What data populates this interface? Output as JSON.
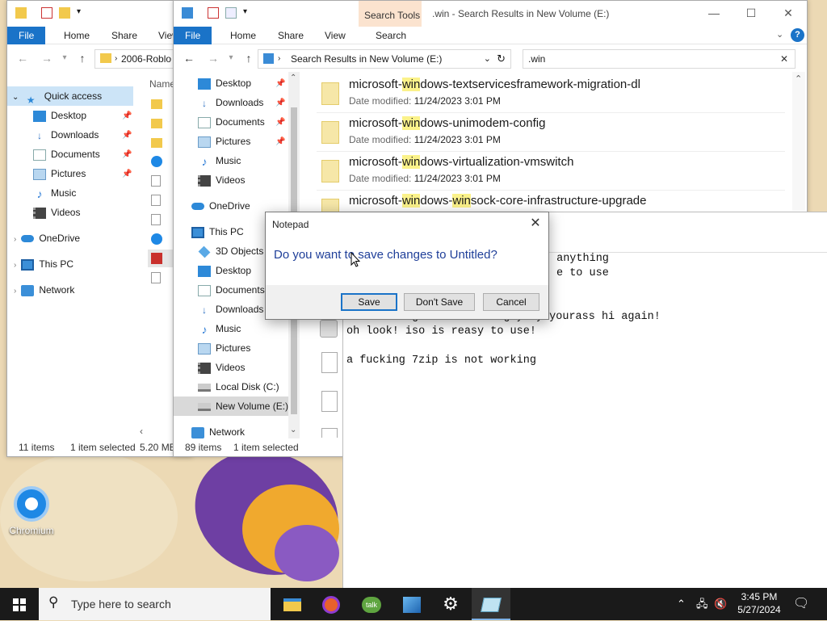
{
  "desktop": {
    "icons": [
      {
        "label": "Chromium",
        "icon": "chromium-icon"
      }
    ]
  },
  "explorer_back": {
    "ribbon_tabs": [
      "File",
      "Home",
      "Share",
      "View"
    ],
    "address": "2006-Roblo",
    "nav": {
      "quick_access": "Quick access",
      "items": [
        "Desktop",
        "Downloads",
        "Documents",
        "Pictures",
        "Music",
        "Videos"
      ],
      "onedrive": "OneDrive",
      "this_pc": "This PC",
      "network": "Network"
    },
    "column_header": "Name",
    "status": {
      "count": "11 items",
      "selected": "1 item selected",
      "size": "5.20 MB"
    }
  },
  "explorer_front": {
    "title": ".win - Search Results in New Volume (E:)",
    "contextual_tab": "Search Tools",
    "ribbon_tabs": [
      "File",
      "Home",
      "Share",
      "View",
      "Search"
    ],
    "address": "Search Results in New Volume (E:)",
    "search_query": ".win",
    "nav": {
      "quick_items": [
        "Desktop",
        "Downloads",
        "Documents",
        "Pictures",
        "Music",
        "Videos"
      ],
      "onedrive": "OneDrive",
      "this_pc": "This PC",
      "pc_items": [
        "3D Objects",
        "Desktop",
        "Documents",
        "Downloads",
        "Music",
        "Pictures",
        "Videos",
        "Local Disk (C:)",
        "New Volume (E:)"
      ],
      "network": "Network"
    },
    "results": [
      {
        "pre": "microsoft-",
        "hl": "win",
        "post": "dows-textservicesframework-migration-dl",
        "date_label": "Date modified:",
        "date": "11/24/2023 3:01 PM"
      },
      {
        "pre": "microsoft-",
        "hl": "win",
        "post": "dows-unimodem-config",
        "date_label": "Date modified:",
        "date": "11/24/2023 3:01 PM"
      },
      {
        "pre": "microsoft-",
        "hl": "win",
        "post": "dows-virtualization-vmswitch",
        "date_label": "Date modified:",
        "date": "11/24/2023 3:01 PM"
      },
      {
        "pre": "microsoft-",
        "hl": "win",
        "post": "dows-",
        "hl2": "win",
        "post2": "sock-core-infrastructure-upgrade"
      }
    ],
    "status": {
      "count": "89 items",
      "selected": "1 item selected"
    }
  },
  "notepad": {
    "lines": [
      " anything",
      "e to use",
      "",
      "im a fucing cat that is gay by yourass hi again!",
      "oh look! iso is reasy to use!",
      "",
      "a fucking 7zip is not working"
    ]
  },
  "dialog": {
    "title": "Notepad",
    "message": "Do you want to save changes to Untitled?",
    "buttons": {
      "save": "Save",
      "dont_save": "Don't Save",
      "cancel": "Cancel"
    }
  },
  "taskbar": {
    "search_placeholder": "Type here to search",
    "time": "3:45 PM",
    "date": "5/27/2024"
  },
  "colors": {
    "accent": "#1a73c8",
    "highlight": "#fbf28a",
    "dialog_text": "#1f3f99"
  }
}
